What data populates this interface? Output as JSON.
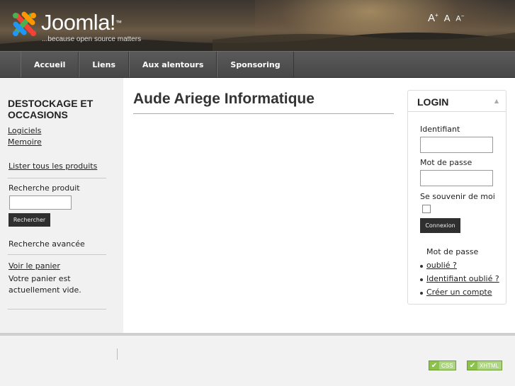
{
  "header": {
    "logo_text": "Joomla!",
    "logo_tm": "™",
    "tagline": "...because open source matters",
    "font_size": {
      "larger": "A",
      "larger_sup": "+",
      "normal": "A",
      "smaller": "A",
      "smaller_sup": "−"
    }
  },
  "nav": {
    "items": [
      {
        "label": "Accueil"
      },
      {
        "label": "Liens"
      },
      {
        "label": "Aux alentours"
      },
      {
        "label": "Sponsoring"
      }
    ]
  },
  "sidebar": {
    "title": "DESTOCKAGE ET OCCASIONS",
    "categories": [
      {
        "label": "Logiciels"
      },
      {
        "label": "Memoire"
      }
    ],
    "list_all": "Lister tous les produits",
    "search_label": "Recherche produit",
    "search_button": "Rechercher",
    "advanced_search": "Recherche avancée",
    "cart_link": "Voir le panier",
    "cart_status": "Votre panier est actuellement vide."
  },
  "main": {
    "title": "Aude Ariege Informatique"
  },
  "login": {
    "title": "LOGIN",
    "collapse_icon": "▲",
    "username_label": "Identifiant",
    "password_label": "Mot de passe",
    "remember_label": "Se souvenir de moi",
    "submit": "Connexion",
    "links": {
      "forgot_password_prefix": "Mot de passe",
      "forgot_password_link": "oublié ?",
      "forgot_username": "Identifiant oublié ?",
      "create_account": "Créer un compte"
    }
  },
  "footer": {
    "badges": [
      {
        "label": "CSS"
      },
      {
        "label": "XHTML"
      }
    ]
  },
  "colors": {
    "nav_bg": "#4d4d4d",
    "button_bg": "#2f2f2f",
    "badge_green": "#8bc34a"
  }
}
